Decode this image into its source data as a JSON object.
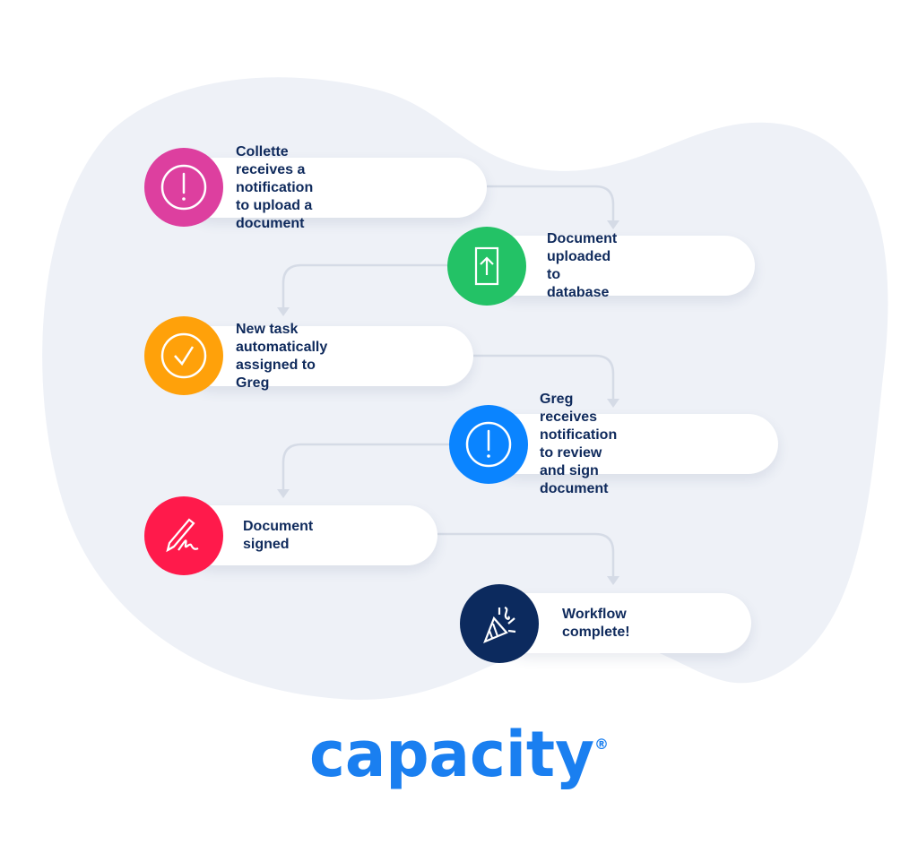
{
  "colors": {
    "background_blob": "#eef1f7",
    "connector": "#d5dbe6",
    "text": "#0f2a5c",
    "logo": "#1a7ff0"
  },
  "steps": [
    {
      "lines": [
        "Collette receives a notification",
        "to upload a document"
      ],
      "icon": "exclamation-circle-icon",
      "color": "#dd3f9f"
    },
    {
      "lines": [
        "Document uploaded",
        "to database"
      ],
      "icon": "document-upload-icon",
      "color": "#23c266"
    },
    {
      "lines": [
        "New task automatically",
        "assigned to Greg"
      ],
      "icon": "check-circle-icon",
      "color": "#ffa10a"
    },
    {
      "lines": [
        "Greg receives notification",
        "to review and sign document"
      ],
      "icon": "exclamation-circle-icon",
      "color": "#0a84ff"
    },
    {
      "lines": [
        "Document signed"
      ],
      "icon": "pen-signature-icon",
      "color": "#ff1a4b"
    },
    {
      "lines": [
        "Workflow complete!"
      ],
      "icon": "party-popper-icon",
      "color": "#0c2a5e"
    }
  ],
  "logo": {
    "text": "capacity",
    "mark": "®"
  }
}
